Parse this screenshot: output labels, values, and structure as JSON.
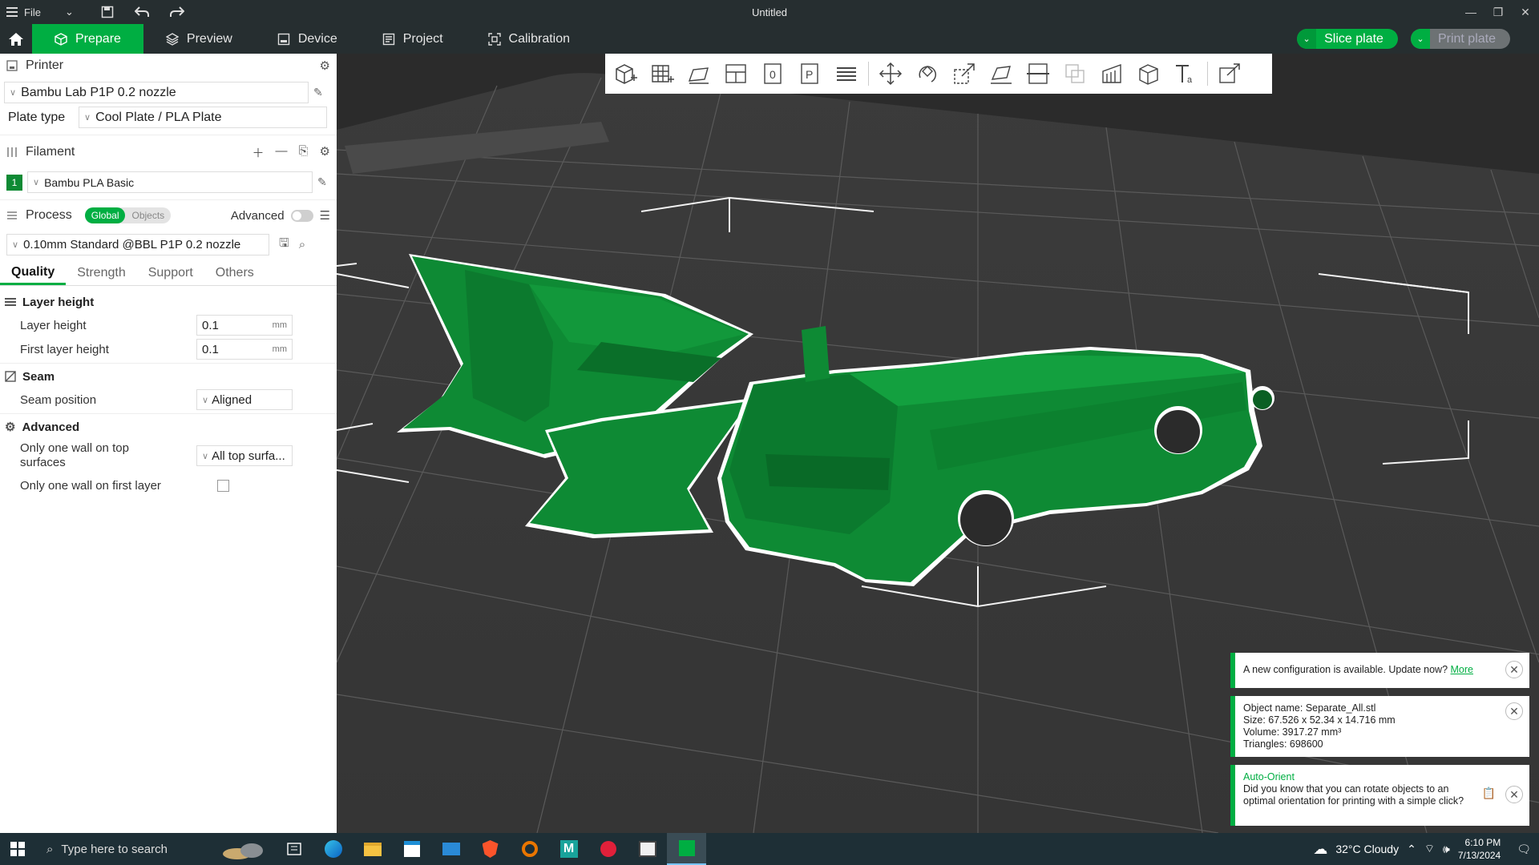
{
  "titlebar": {
    "file_label": "File",
    "window_title": "Untitled"
  },
  "nav": {
    "tabs": [
      {
        "label": "Prepare",
        "active": true
      },
      {
        "label": "Preview"
      },
      {
        "label": "Device"
      },
      {
        "label": "Project"
      },
      {
        "label": "Calibration"
      }
    ],
    "slice_plate": "Slice plate",
    "print_plate": "Print plate"
  },
  "printer": {
    "section": "Printer",
    "name": "Bambu Lab P1P 0.2 nozzle",
    "plate_type_label": "Plate type",
    "plate_type": "Cool Plate / PLA Plate"
  },
  "filament": {
    "section": "Filament",
    "slot": "1",
    "name": "Bambu PLA Basic"
  },
  "process": {
    "section": "Process",
    "toggle_global": "Global",
    "toggle_objects": "Objects",
    "advanced_label": "Advanced",
    "preset": "0.10mm Standard @BBL P1P 0.2 nozzle",
    "tabs": [
      "Quality",
      "Strength",
      "Support",
      "Others"
    ]
  },
  "quality": {
    "layer_height_group": "Layer height",
    "layer_height_label": "Layer height",
    "layer_height_value": "0.1",
    "first_layer_height_label": "First layer height",
    "first_layer_height_value": "0.1",
    "unit": "mm",
    "seam_group": "Seam",
    "seam_position_label": "Seam position",
    "seam_position_value": "Aligned",
    "advanced_group": "Advanced",
    "one_wall_top_label": "Only one wall on top surfaces",
    "one_wall_top_value": "All top surfa...",
    "one_wall_first_label": "Only one wall on first layer",
    "one_wall_first_checked": false
  },
  "notifications": {
    "config": {
      "text": "A new configuration is available. Update now?",
      "link": "More"
    },
    "object": {
      "name": "Object name: Separate_All.stl",
      "size": "Size: 67.526 x 52.34 x 14.716 mm",
      "volume": "Volume: 3917.27 mm³",
      "triangles": "Triangles: 698600"
    },
    "orient": {
      "title": "Auto-Orient",
      "text": "Did you know that you can rotate objects to an optimal orientation for printing with a simple click?"
    }
  },
  "taskbar": {
    "search_placeholder": "Type here to search",
    "weather": "32°C  Cloudy",
    "time": "6:10 PM",
    "date": "7/13/2024"
  },
  "colors": {
    "accent": "#00ae42",
    "model": "#0e8a34",
    "bed": "#2b2b2b"
  }
}
